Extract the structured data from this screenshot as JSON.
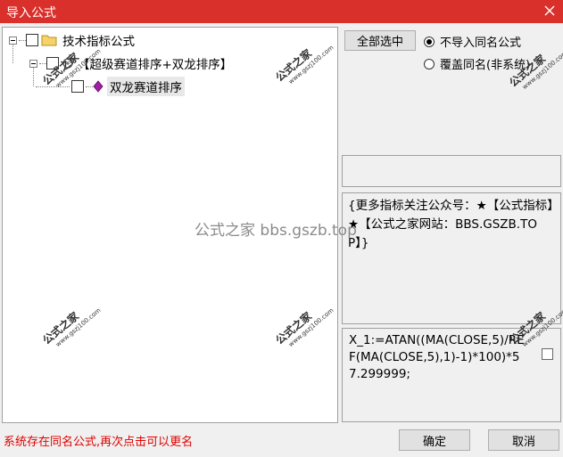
{
  "window": {
    "title": "导入公式",
    "close_icon": "close-icon"
  },
  "tree": {
    "root_label": "技术指标公式",
    "group_label": "【超级赛道排序+双龙排序】",
    "item_label": "双龙赛道排序"
  },
  "buttons": {
    "select_all": "全部选中",
    "ok": "确定",
    "cancel": "取消"
  },
  "options": {
    "no_import_same_name": "不导入同名公式",
    "overwrite_same_name": "覆盖同名(非系统)",
    "selected": "no_import_same_name"
  },
  "description": "{更多指标关注公众号：★【公式指标】★【公式之家网站：BBS.GSZB.TOP】}",
  "formula": "X_1:=ATAN((MA(CLOSE,5)/REF(MA(CLOSE,5),1)-1)*100)*57.299999;",
  "status_message": "系统存在同名公式,再次点击可以更名",
  "watermark": {
    "center": "公式之家 bbs.gszb.top",
    "stamp_text": "公式之家",
    "stamp_url": "www.gszj100.com"
  },
  "colors": {
    "titlebar": "#d9302c",
    "status_text": "#e00000"
  }
}
